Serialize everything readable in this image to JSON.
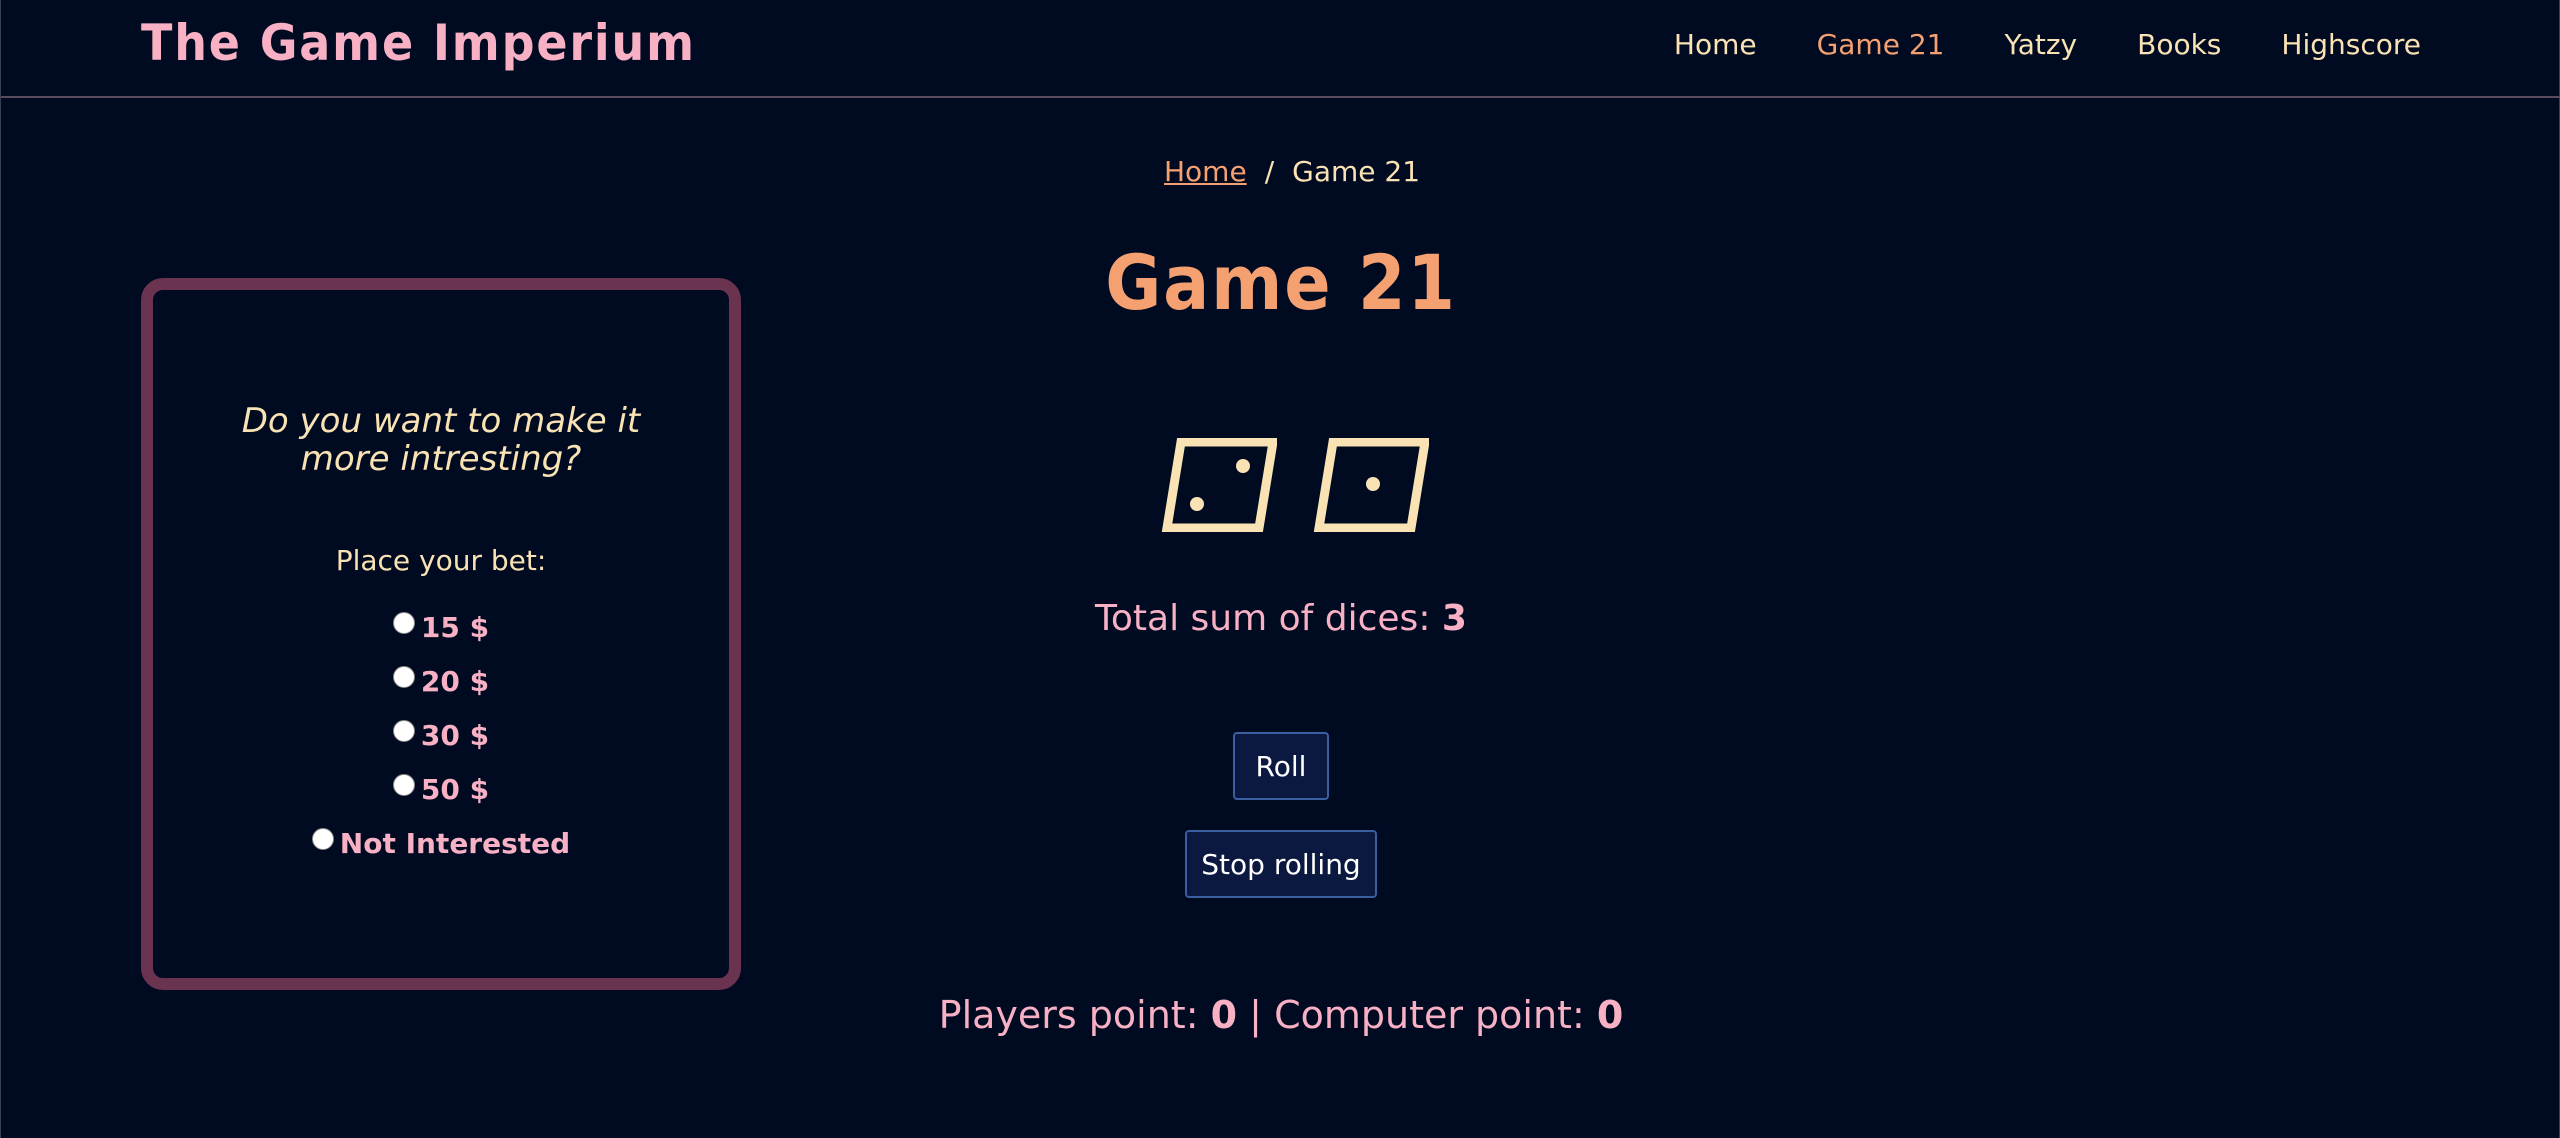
{
  "header": {
    "logo": "The Game Imperium",
    "nav": [
      {
        "label": "Home",
        "active": false
      },
      {
        "label": "Game 21",
        "active": true
      },
      {
        "label": "Yatzy",
        "active": false
      },
      {
        "label": "Books",
        "active": false
      },
      {
        "label": "Highscore",
        "active": false
      }
    ]
  },
  "breadcrumb": {
    "home": "Home",
    "separator": "/",
    "current": "Game 21"
  },
  "title": "Game 21",
  "dice": [
    {
      "face": 2,
      "icon": "die-face-2-icon"
    },
    {
      "face": 1,
      "icon": "die-face-1-icon"
    }
  ],
  "sum": {
    "label": "Total sum of dices:",
    "value": "3"
  },
  "buttons": {
    "roll": "Roll",
    "stop": "Stop rolling"
  },
  "points": {
    "player_label": "Players point:",
    "player_value": "0",
    "separator": "|",
    "computer_label": "Computer point:",
    "computer_value": "0"
  },
  "bet": {
    "question_line1": "Do you want to make it",
    "question_line2": "more intresting?",
    "label": "Place your bet:",
    "options": [
      "15 $",
      "20 $",
      "30 $",
      "50 $",
      "Not Interested"
    ],
    "selected": null
  },
  "colors": {
    "background": "#000a21",
    "accent": "#f4a070",
    "pink": "#f7b0c4",
    "cream": "#f9e2b3",
    "panel_border": "#6a3350",
    "button_bg": "#0b1840",
    "button_border": "#3a5fa0"
  }
}
